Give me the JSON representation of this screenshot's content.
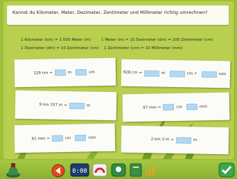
{
  "question": "Kannst du Kilometer, Meter, Dezimeter, Zentimeter und Millimeter richtig umrechnen?",
  "references": [
    "1 Kilometer (km) = 1 000 Meter (m)",
    "1 Meter (m) = 10 Dezimeter (dm) = 100 Zentimeter (cm)",
    "1 Dezimeter (dm) = 10 Zentimeter (cm)",
    "1 Zentimeter (cm) = 10 Millimeter (mm)"
  ],
  "tasks": [
    {
      "prefix": "129 cm =",
      "units": [
        "m",
        "cm"
      ]
    },
    {
      "prefix": "928 cm =",
      "units": [
        "m",
        "cm =",
        "mm"
      ]
    },
    {
      "prefix": "9 km 337 m =",
      "units": [
        "m"
      ]
    },
    {
      "prefix": "97 mm =",
      "units": [
        "cm",
        "mm"
      ]
    },
    {
      "prefix": "61 mm =",
      "units": [
        "cm",
        "mm"
      ]
    },
    {
      "prefix": "2 km 3 m =",
      "units": [
        "m"
      ]
    }
  ],
  "toolbar": {
    "items": [
      "ink-bottle-icon",
      "back-arrow-icon",
      "clock-icon",
      "meter-icon",
      "hint-icon",
      "book-icon",
      "stats-icon",
      "check-icon"
    ]
  },
  "colors": {
    "background": "#b8cf4f",
    "input_box": "#b3d8f1",
    "card": "#fbfbf7",
    "toolbar": "#9dbf3a"
  }
}
